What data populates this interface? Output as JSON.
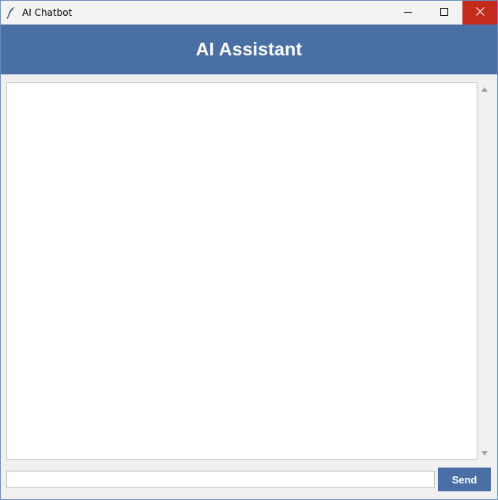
{
  "window": {
    "title": "AI Chatbot",
    "icon": "feather-icon",
    "controls": {
      "minimize_icon": "minimize-icon",
      "maximize_icon": "maximize-icon",
      "close_icon": "close-icon"
    }
  },
  "header": {
    "title": "AI Assistant",
    "background": "#4a6fa5",
    "text_color": "#ffffff"
  },
  "chat": {
    "messages": []
  },
  "input": {
    "value": "",
    "placeholder": ""
  },
  "send_button": {
    "label": "Send",
    "background": "#4a6fa5"
  },
  "colors": {
    "accent": "#4a6fa5",
    "close_button": "#c42b1c"
  }
}
